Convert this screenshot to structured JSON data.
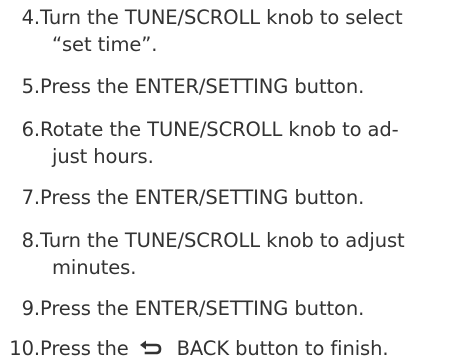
{
  "steps": [
    {
      "number": "4.",
      "lines": [
        "Turn the TUNE/SCROLL knob to select",
        "“set time”."
      ]
    },
    {
      "number": "5.",
      "lines": [
        "Press the ENTER/SETTING button."
      ]
    },
    {
      "number": "6.",
      "lines": [
        "Rotate the TUNE/SCROLL knob to ad-",
        "just hours."
      ]
    },
    {
      "number": "7.",
      "lines": [
        "Press the ENTER/SETTING button."
      ]
    },
    {
      "number": "8.",
      "lines": [
        "Turn the TUNE/SCROLL knob to adjust",
        "minutes."
      ]
    },
    {
      "number": "9.",
      "lines": [
        "Press the ENTER/SETTING button."
      ]
    },
    {
      "number": "10.",
      "before_icon": "Press the",
      "icon": "back-arrow-icon",
      "after_icon": "BACK button to finish."
    }
  ]
}
